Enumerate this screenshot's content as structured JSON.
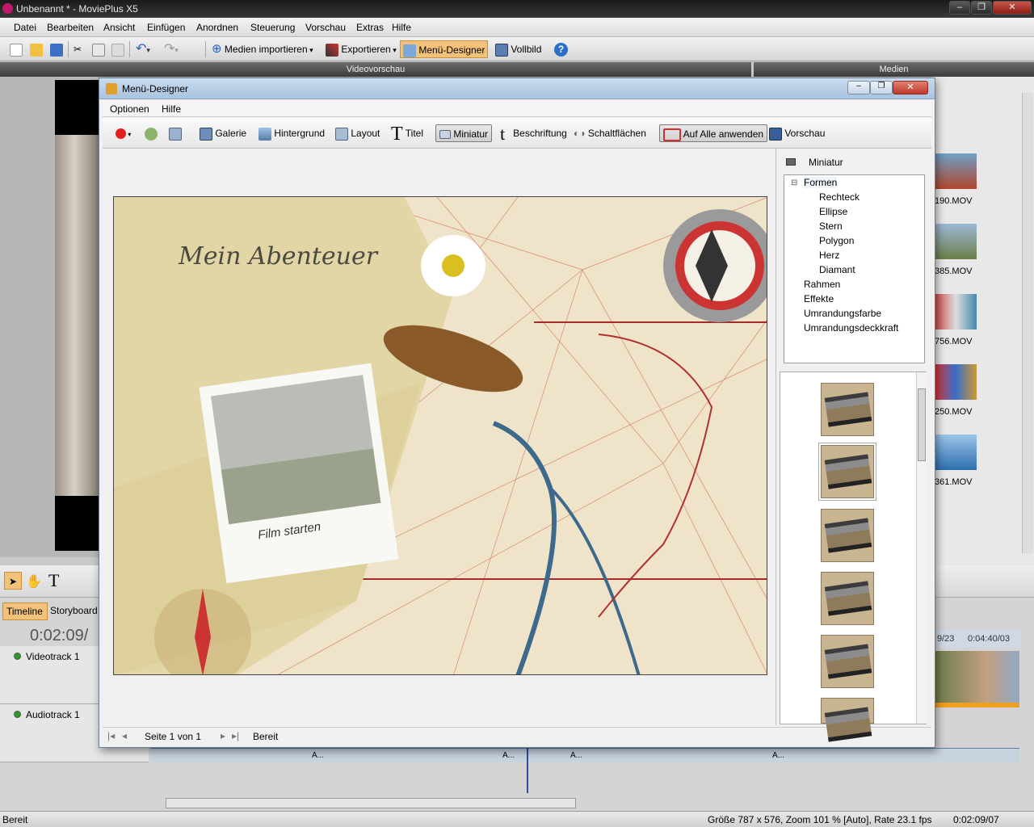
{
  "app": {
    "title": "Unbenannt * - MoviePlus X5"
  },
  "menu": [
    "Datei",
    "Bearbeiten",
    "Ansicht",
    "Einfügen",
    "Anordnen",
    "Steuerung",
    "Vorschau",
    "Extras",
    "Hilfe"
  ],
  "toolbar": {
    "import": "Medien importieren",
    "export": "Exportieren",
    "menu_designer": "Menü-Designer",
    "fullscreen": "Vollbild"
  },
  "panels": {
    "video_preview": "Videovorschau",
    "media": "Medien"
  },
  "media_files": [
    "190.MOV",
    "385.MOV",
    "756.MOV",
    "250.MOV",
    "361.MOV"
  ],
  "timeline": {
    "tab_timeline": "Timeline",
    "tab_storyboard": "Storyboard",
    "time": "0:02:09/",
    "videotrack": "Videotrack 1",
    "audiotrack": "Audiotrack 1",
    "ruler_a": "9/23",
    "ruler_b": "0:04:40/03",
    "clip_label": "A..."
  },
  "dialog": {
    "title": "Menü-Designer",
    "menu": [
      "Optionen",
      "Hilfe"
    ],
    "tools": {
      "galerie": "Galerie",
      "hintergrund": "Hintergrund",
      "layout": "Layout",
      "titel": "Titel",
      "miniatur": "Miniatur",
      "beschriftung": "Beschriftung",
      "schaltflaechen": "Schaltflächen",
      "auf_alle": "Auf Alle anwenden",
      "vorschau": "Vorschau"
    },
    "preview": {
      "heading": "Mein Abenteuer",
      "caption": "Film starten"
    },
    "panel_title": "Miniatur",
    "tree": {
      "formen": "Formen",
      "formen_children": [
        "Rechteck",
        "Ellipse",
        "Stern",
        "Polygon",
        "Herz",
        "Diamant"
      ],
      "others": [
        "Rahmen",
        "Effekte",
        "Umrandungsfarbe",
        "Umrandungsdeckkraft"
      ]
    },
    "status_page": "Seite 1 von 1",
    "status_ready": "Bereit"
  },
  "statusbar": {
    "left": "Bereit",
    "info": "Größe 787 x 576, Zoom 101 % [Auto], Rate 23.1 fps",
    "time": "0:02:09/07"
  },
  "colors": {
    "accent_toggle": "#f3c27a",
    "selection": "#ffd27a"
  }
}
